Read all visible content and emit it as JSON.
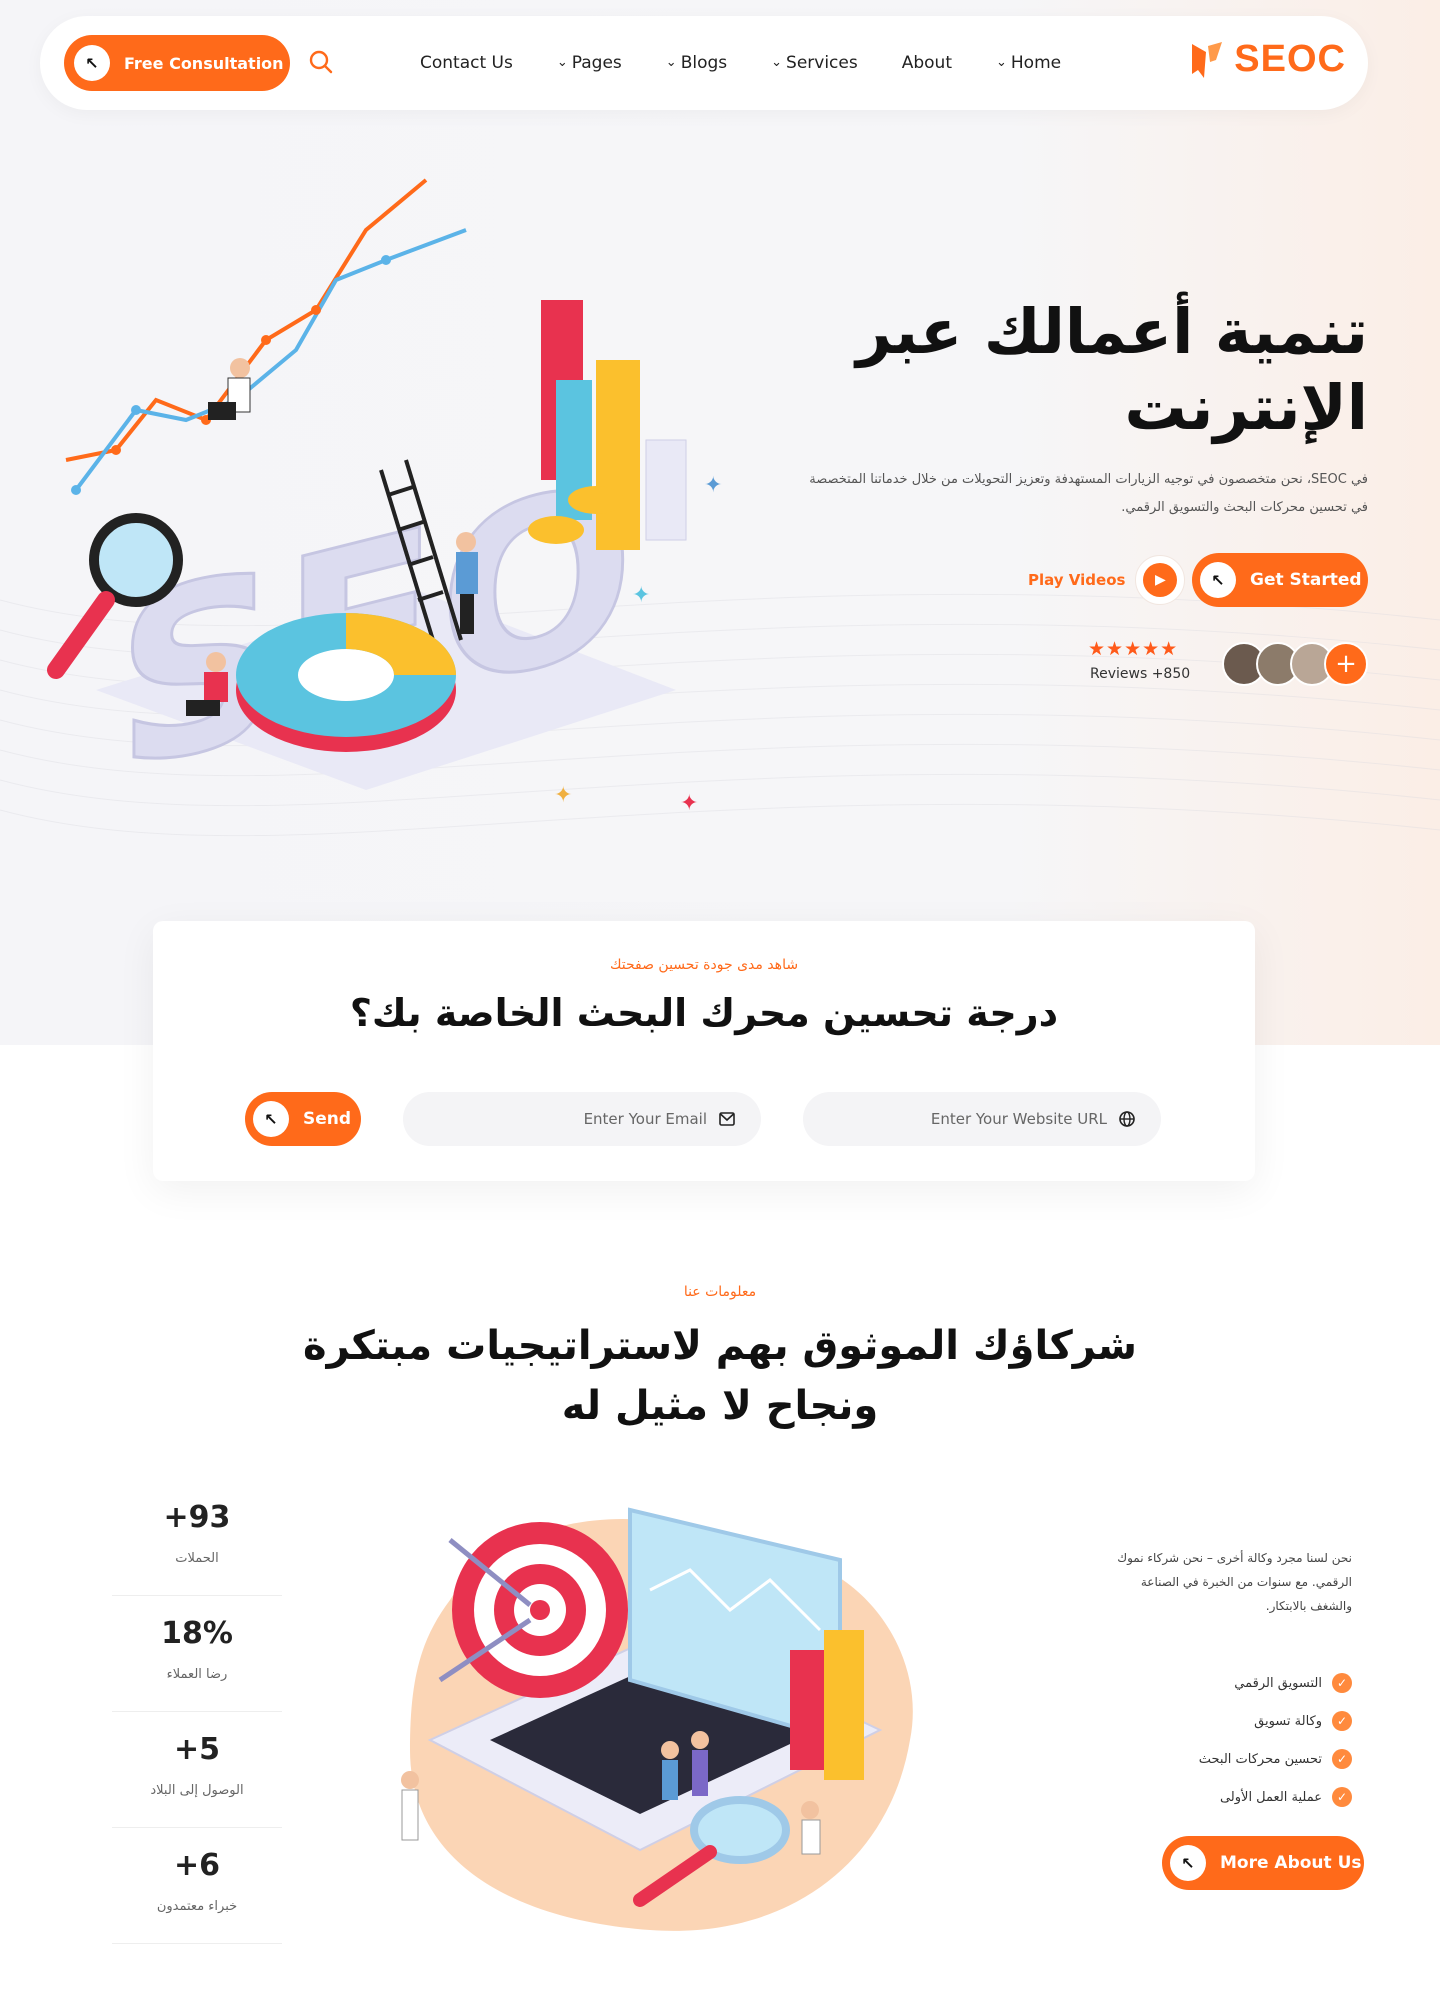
{
  "nav": {
    "consult_label": "Free Consultation",
    "links": [
      "Contact Us",
      "Pages",
      "Blogs",
      "Services",
      "About",
      "Home"
    ],
    "logo_text": "SEOC",
    "brand_color": "#ff6a1a"
  },
  "hero": {
    "title_line1": "تنمية أعمالك عبر",
    "title_line2": "الإنترنت",
    "description": "في SEOC، نحن متخصصون في توجيه الزيارات المستهدفة وتعزيز التحويلات من خلال خدماتنا المتخصصة في تحسين محركات البحث والتسويق الرقمي.",
    "get_started": "Get Started",
    "play_label": "Play Videos",
    "stars": "★★★★★",
    "reviews": "Reviews +850"
  },
  "seo_card": {
    "subtitle": "شاهد مدى جودة تحسين صفحتك",
    "title": "درجة تحسين محرك البحث الخاصة بك؟",
    "url_placeholder": "Enter Your Website URL",
    "email_placeholder": "Enter Your Email",
    "send_label": "Send"
  },
  "about": {
    "subtitle": "معلومات عنا",
    "title": "شركاؤك الموثوق بهم لاستراتيجيات مبتكرة ونجاح لا مثيل له",
    "stats": [
      {
        "value": "+93",
        "label": "الحملات"
      },
      {
        "value": "18%",
        "label": "رضا العملاء"
      },
      {
        "value": "+5",
        "label": "الوصول إلى البلاد"
      },
      {
        "value": "+6",
        "label": "خبراء معتمدون"
      }
    ],
    "description": "نحن لسنا مجرد وكالة أخرى – نحن شركاء نموك الرقمي. مع سنوات من الخبرة في الصناعة والشغف بالابتكار.",
    "checklist": [
      "التسويق الرقمي",
      "وكالة تسويق",
      "تحسين محركات البحث",
      "عملية العمل الأولى"
    ],
    "more_label": "More About Us"
  }
}
